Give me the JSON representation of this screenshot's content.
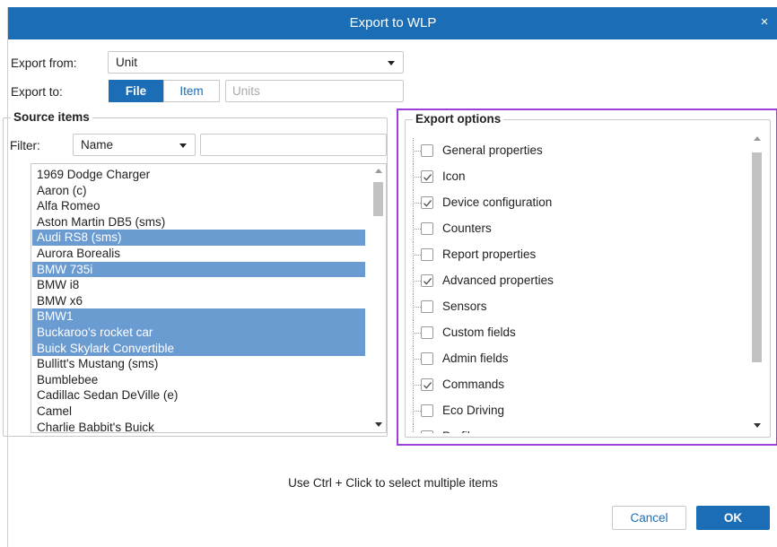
{
  "window": {
    "title": "Export to WLP",
    "close_glyph": "×"
  },
  "export_from": {
    "label": "Export from:",
    "value": "Unit"
  },
  "export_to": {
    "label": "Export to:",
    "options": [
      {
        "label": "File",
        "active": true
      },
      {
        "label": "Item",
        "active": false
      }
    ],
    "units_placeholder": "Units"
  },
  "source": {
    "legend": "Source items",
    "filter_label": "Filter:",
    "filter_value": "Name",
    "filter_input": "",
    "items": [
      {
        "label": "1969 Dodge Charger",
        "selected": false
      },
      {
        "label": "Aaron (c)",
        "selected": false
      },
      {
        "label": "Alfa Romeo",
        "selected": false
      },
      {
        "label": "Aston Martin DB5 (sms)",
        "selected": false
      },
      {
        "label": "Audi RS8 (sms)",
        "selected": true
      },
      {
        "label": "Aurora Borealis",
        "selected": false
      },
      {
        "label": "BMW 735i",
        "selected": true
      },
      {
        "label": "BMW i8",
        "selected": false
      },
      {
        "label": "BMW x6",
        "selected": false
      },
      {
        "label": "BMW1",
        "selected": true
      },
      {
        "label": "Buckaroo's rocket car",
        "selected": true
      },
      {
        "label": "Buick Skylark Convertible",
        "selected": true
      },
      {
        "label": "Bullitt's Mustang (sms)",
        "selected": false
      },
      {
        "label": "Bumblebee",
        "selected": false
      },
      {
        "label": "Cadillac Sedan DeVille (e)",
        "selected": false
      },
      {
        "label": "Camel",
        "selected": false
      },
      {
        "label": "Charlie Babbit's Buick",
        "selected": false
      }
    ]
  },
  "options": {
    "legend": "Export options",
    "items": [
      {
        "label": "General properties",
        "checked": false
      },
      {
        "label": "Icon",
        "checked": true
      },
      {
        "label": "Device configuration",
        "checked": true
      },
      {
        "label": "Counters",
        "checked": false
      },
      {
        "label": "Report properties",
        "checked": false
      },
      {
        "label": "Advanced properties",
        "checked": true
      },
      {
        "label": "Sensors",
        "checked": false
      },
      {
        "label": "Custom fields",
        "checked": false
      },
      {
        "label": "Admin fields",
        "checked": false
      },
      {
        "label": "Commands",
        "checked": true
      },
      {
        "label": "Eco Driving",
        "checked": false
      },
      {
        "label": "Profile",
        "checked": false
      }
    ]
  },
  "hint": "Use Ctrl + Click to select multiple items",
  "buttons": {
    "cancel": "Cancel",
    "ok": "OK"
  },
  "colors": {
    "accent": "#1b6db5",
    "selection": "#6a9bd1",
    "highlight": "#9b3fd8"
  }
}
